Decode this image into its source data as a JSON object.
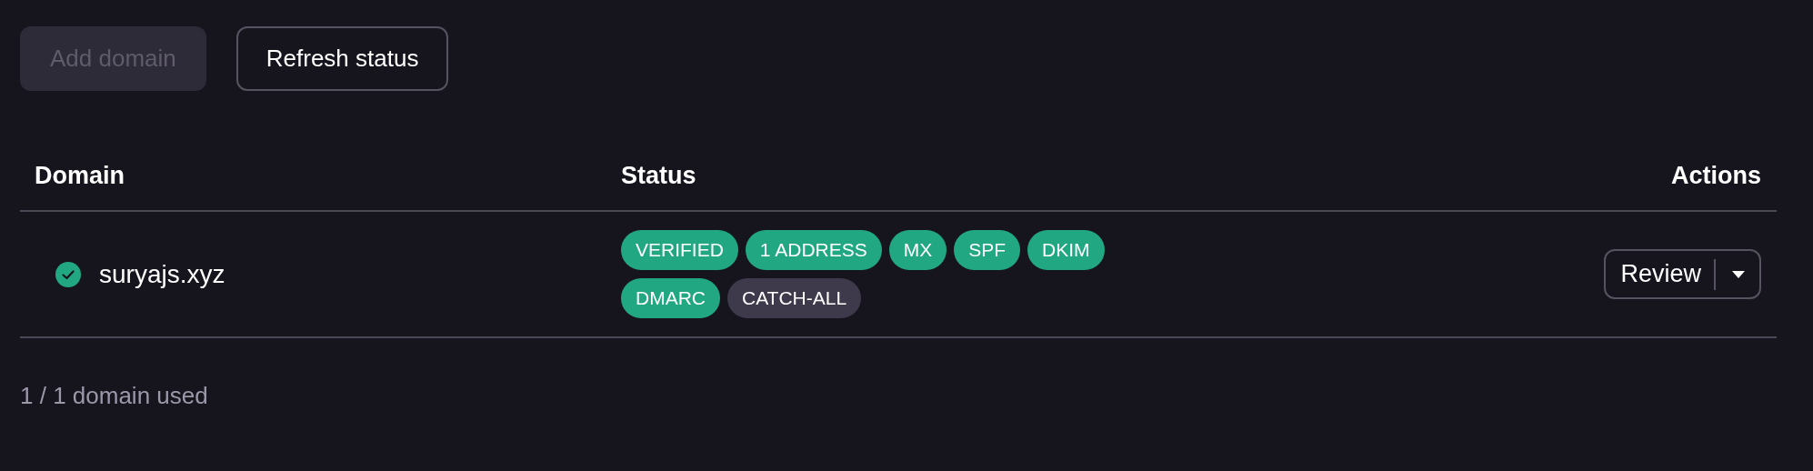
{
  "toolbar": {
    "buttons": [
      {
        "label": "Add domain",
        "disabled": true
      },
      {
        "label": "Refresh status",
        "disabled": false
      }
    ]
  },
  "table": {
    "columns": [
      "Domain",
      "Status",
      "Actions"
    ],
    "rows": [
      {
        "domain": "suryajs.xyz",
        "verified": true,
        "badges": [
          {
            "label": "VERIFIED",
            "color": "#21a883"
          },
          {
            "label": "1 ADDRESS",
            "color": "#21a883"
          },
          {
            "label": "MX",
            "color": "#21a883"
          },
          {
            "label": "SPF",
            "color": "#21a883"
          },
          {
            "label": "DKIM",
            "color": "#21a883"
          },
          {
            "label": "DMARC",
            "color": "#21a883"
          },
          {
            "label": "CATCH-ALL",
            "color": "#3e3a4b"
          }
        ],
        "action": "Review"
      }
    ]
  },
  "footer": "1 / 1 domain used"
}
